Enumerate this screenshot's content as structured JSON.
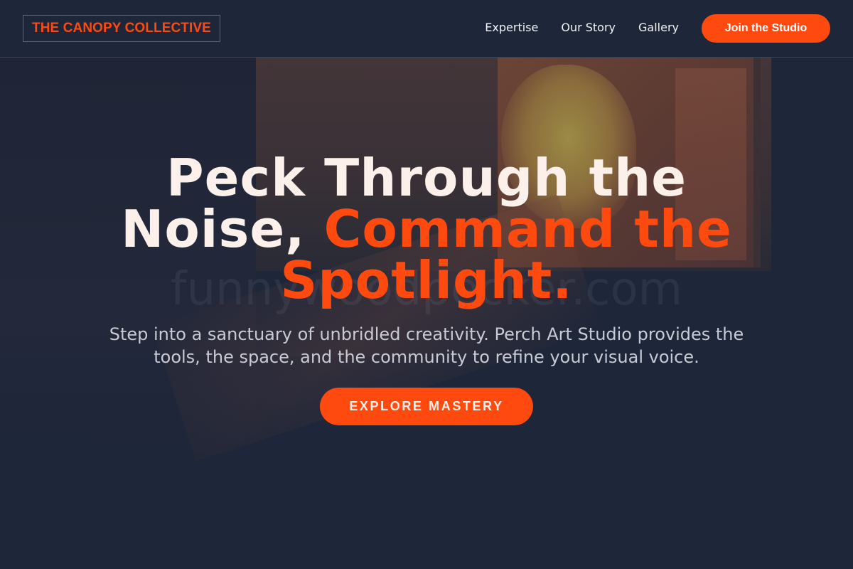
{
  "nav": {
    "logo": "THE CANOPY COLLECTIVE",
    "links": [
      "Expertise",
      "Our Story",
      "Gallery"
    ],
    "cta": "Join the Studio"
  },
  "hero": {
    "title_part1": "Peck Through the Noise, ",
    "title_accent": "Command the Spotlight.",
    "subtitle": "Step into a sanctuary of unbridled creativity. Perch Art Studio provides the tools, the space, and the community to refine your visual voice.",
    "cta": "EXPLORE MASTERY",
    "watermark": "funnywoodpecker.com"
  },
  "colors": {
    "accent": "#ff4a0f",
    "background": "#1e2639",
    "heading": "#fbf1ea"
  }
}
